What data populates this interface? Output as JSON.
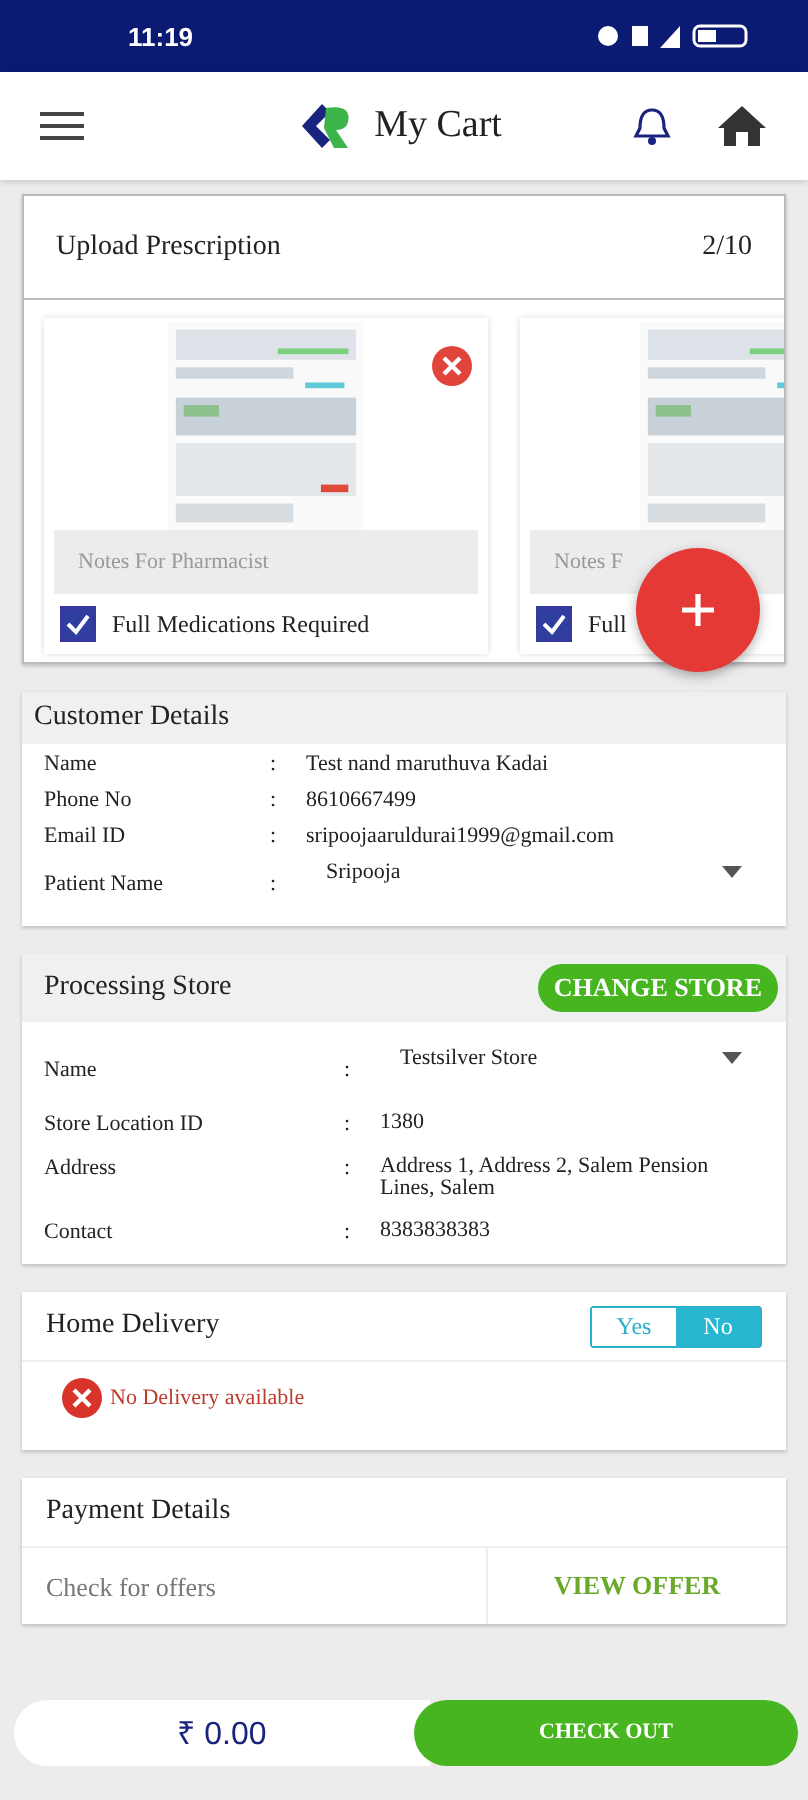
{
  "status_bar": {
    "time": "11:19"
  },
  "header": {
    "title": "My Cart"
  },
  "upload": {
    "title": "Upload Prescription",
    "count": "2/10",
    "prescriptions": [
      {
        "kind": "picture",
        "notes_placeholder": "Notes For Pharmacist",
        "full_medications": {
          "label": "Full Medications Required",
          "checked": true
        },
        "removable": true
      },
      {
        "kind": "picture",
        "notes_placeholder": "Notes F",
        "full_medications": {
          "label": "Full",
          "checked": true
        },
        "removable": false
      }
    ]
  },
  "customer": {
    "title": "Customer Details",
    "separator": ":",
    "rows": [
      {
        "kind": "text",
        "label": "Name",
        "value": "Test nand maruthuva Kadai"
      },
      {
        "kind": "text",
        "label": "Phone No",
        "value": "8610667499"
      },
      {
        "kind": "text",
        "label": "Email ID",
        "value": "sripoojaaruldurai1999@gmail.com"
      },
      {
        "kind": "dropdown",
        "label": "Patient Name",
        "value": "Sripooja"
      }
    ]
  },
  "store": {
    "title": "Processing Store",
    "action": "CHANGE STORE",
    "separator": ":",
    "rows": [
      {
        "kind": "dropdown",
        "label": "Name",
        "value": "Testsilver Store"
      },
      {
        "kind": "text",
        "label": "Store Location ID",
        "value": "1380"
      },
      {
        "kind": "text",
        "label": "Address",
        "value": "Address 1, Address 2, Salem Pension Lines, Salem"
      },
      {
        "kind": "text",
        "label": "Contact",
        "value": "8383838383"
      }
    ]
  },
  "delivery": {
    "title": "Home Delivery",
    "options": [
      {
        "label": "Yes",
        "selected": false
      },
      {
        "label": "No",
        "selected": true
      }
    ],
    "message": "No Delivery available"
  },
  "payment": {
    "title": "Payment Details",
    "offers_label": "Check for offers",
    "offers_action": "VIEW OFFER"
  },
  "footer": {
    "total": "₹ 0.00",
    "checkout": "CHECK OUT"
  }
}
